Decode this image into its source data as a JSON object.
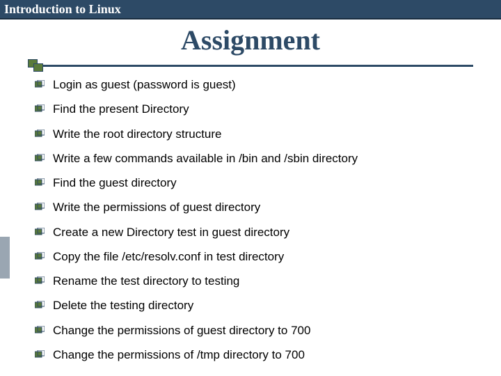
{
  "header": {
    "title": "Introduction to Linux"
  },
  "main": {
    "title": "Assignment"
  },
  "items": [
    {
      "text": "Login as guest (password is guest)"
    },
    {
      "text": "Find the present Directory"
    },
    {
      "text": "Write the root directory structure"
    },
    {
      "text": "Write a few commands available in /bin and /sbin directory"
    },
    {
      "text": "Find the guest directory"
    },
    {
      "text": "Write the permissions of guest directory"
    },
    {
      "text": "Create a new Directory test in guest directory"
    },
    {
      "text": "Copy the file /etc/resolv.conf in test directory"
    },
    {
      "text": "Rename the test directory to testing"
    },
    {
      "text": "Delete the testing directory"
    },
    {
      "text": "Change the permissions of guest directory to 700"
    },
    {
      "text": "Change the permissions of /tmp directory to 700"
    }
  ]
}
